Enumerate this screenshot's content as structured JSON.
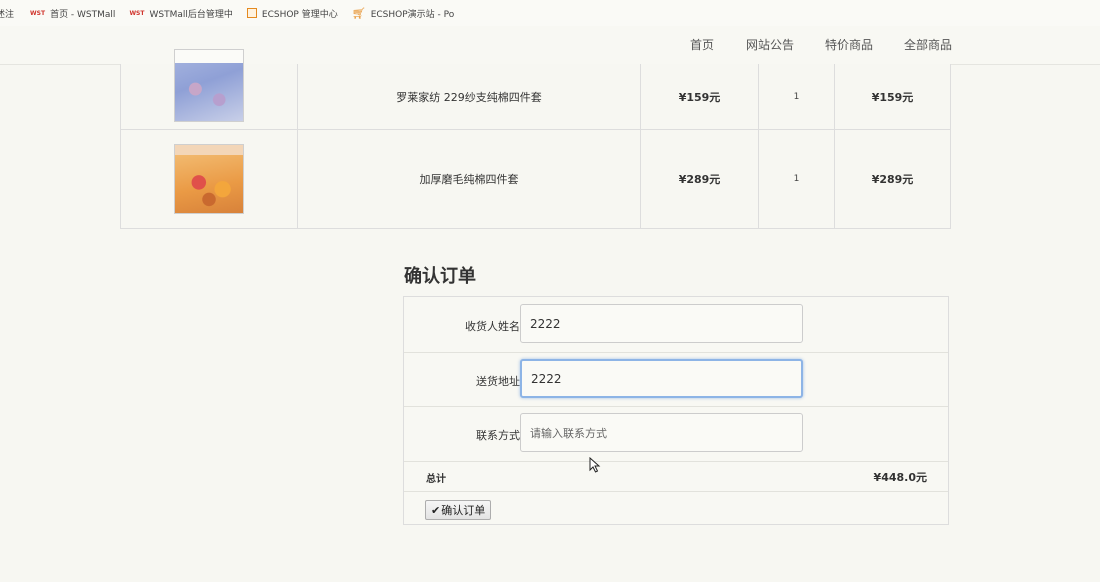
{
  "bookmarks": [
    {
      "icon": "partial-icon",
      "label": "述注"
    },
    {
      "icon": "wst-logo-icon",
      "icon_text": "WST",
      "label": "首页 - WSTMall"
    },
    {
      "icon": "wst-logo-icon",
      "icon_text": "WST",
      "label": "WSTMall后台管理中"
    },
    {
      "icon": "ecshop-box-icon",
      "label": "ECSHOP 管理中心"
    },
    {
      "icon": "cart-icon",
      "label": "ECSHOP演示站 - Po"
    }
  ],
  "nav": {
    "items": [
      "首页",
      "网站公告",
      "特价商品",
      "全部商品"
    ]
  },
  "cart": {
    "rows": [
      {
        "name": "罗莱家纺 229纱支纯棉四件套",
        "price": "¥159元",
        "qty": "1",
        "subtotal": "¥159元"
      },
      {
        "name": "加厚磨毛纯棉四件套",
        "price": "¥289元",
        "qty": "1",
        "subtotal": "¥289元"
      }
    ]
  },
  "order": {
    "title": "确认订单",
    "name_label": "收货人姓名",
    "name_value": "2222",
    "address_label": "送货地址",
    "address_value": "2222",
    "contact_label": "联系方式",
    "contact_placeholder": "请输入联系方式",
    "total_label": "总计",
    "total_value": "¥448.0元",
    "submit_label": "确认订单",
    "submit_icon": "check-icon"
  },
  "colors": {
    "background": "#f7f7f2",
    "focus_border": "#8db4e6",
    "brand_red": "#d0342c"
  }
}
